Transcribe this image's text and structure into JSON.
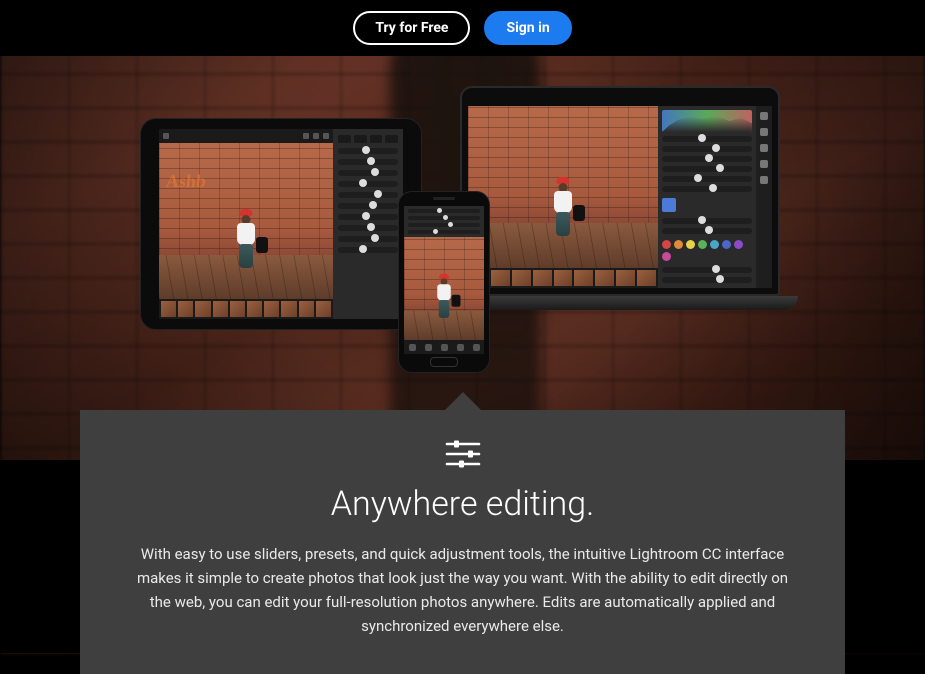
{
  "header": {
    "try_label": "Try for Free",
    "signin_label": "Sign in"
  },
  "feature": {
    "title": "Anywhere editing.",
    "body": "With easy to use sliders, presets, and quick adjustment tools, the intuitive Lightroom CC interface makes it simple to create photos that look just the way you want. With the ability to edit directly on the web, you can edit your full-resolution photos anywhere. Edits are automatically applied and synchronized everywhere else.",
    "icon": "sliders-icon"
  },
  "devices": {
    "graffiti": "Ashb"
  }
}
